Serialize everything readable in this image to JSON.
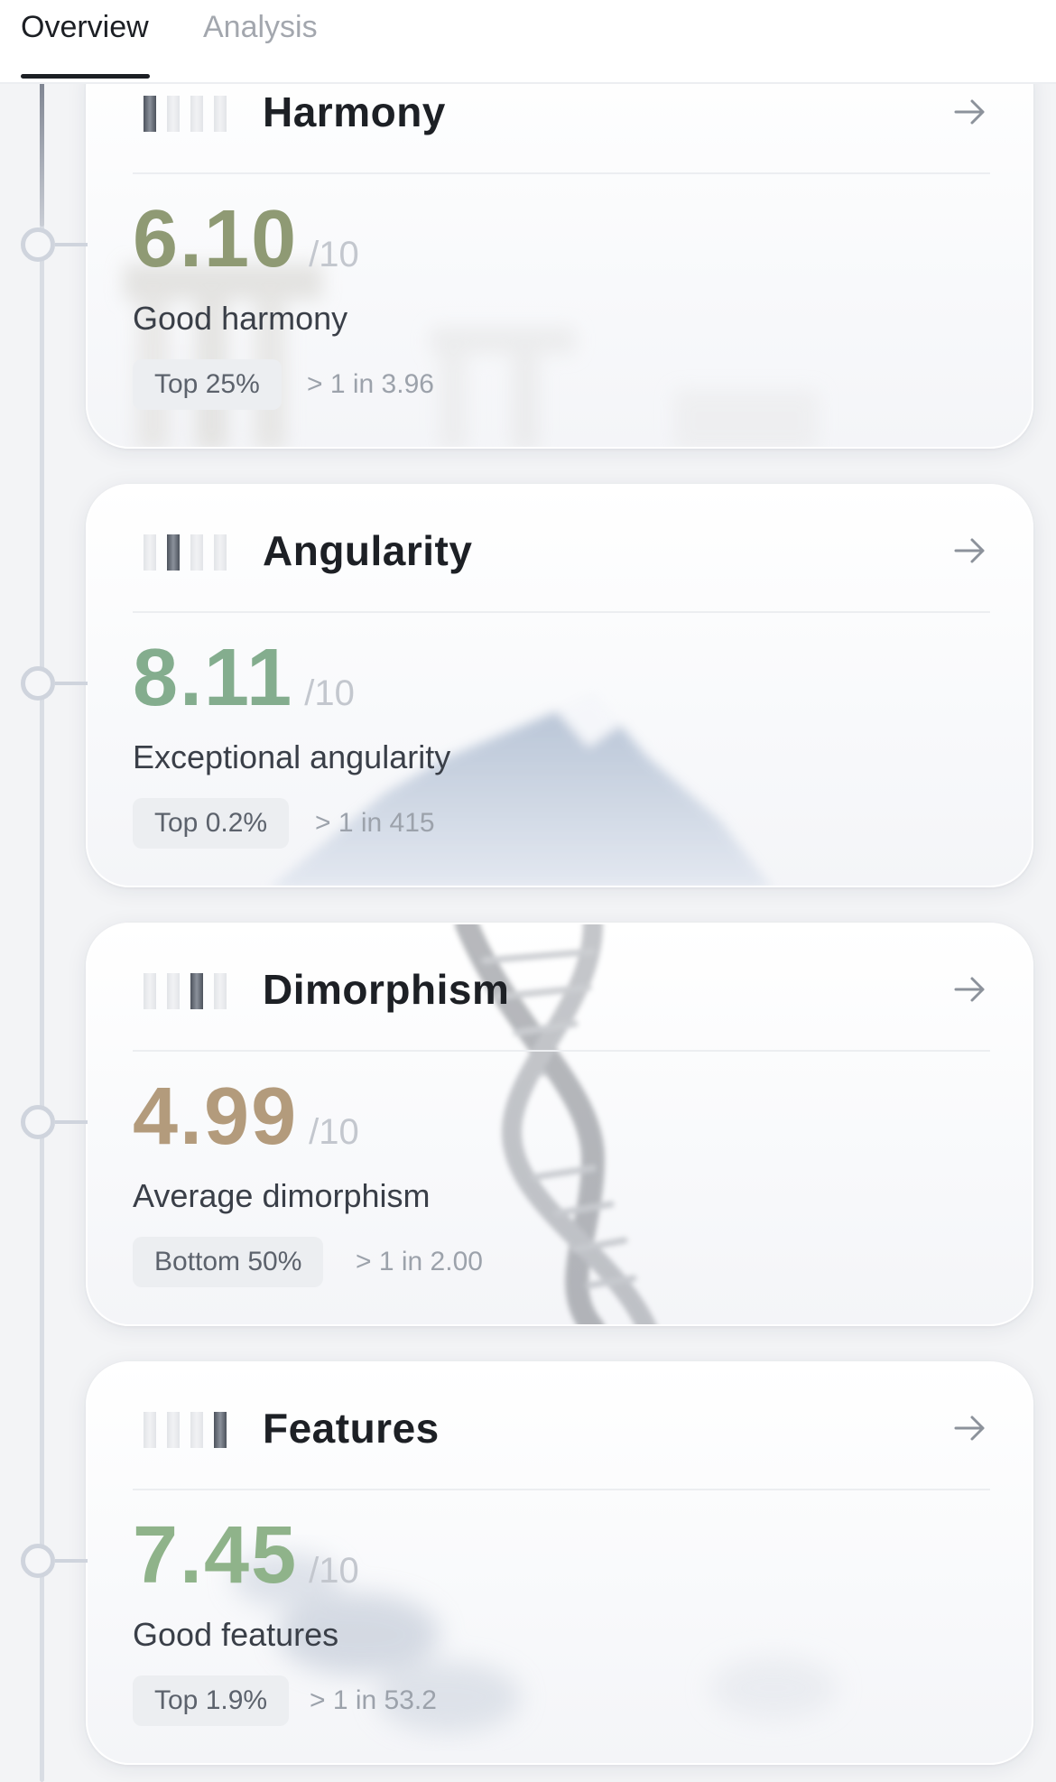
{
  "tabs": {
    "overview_label": "Overview",
    "analysis_label": "Analysis"
  },
  "colors": {
    "harmony_score": "#8f9a74",
    "angularity_score": "#84ad8e",
    "dimorphism_score": "#b39b7c",
    "features_score": "#8fb38a"
  },
  "cards": [
    {
      "title": "Harmony",
      "score": "6.10",
      "score_max": "/10",
      "description": "Good harmony",
      "badge": "Top 25%",
      "rarity": "> 1 in 3.96",
      "level": 1,
      "levels_total": 4,
      "icon": "right-arrow-icon"
    },
    {
      "title": "Angularity",
      "score": "8.11",
      "score_max": "/10",
      "description": "Exceptional angularity",
      "badge": "Top 0.2%",
      "rarity": "> 1 in 415",
      "level": 2,
      "levels_total": 4,
      "icon": "right-arrow-icon"
    },
    {
      "title": "Dimorphism",
      "score": "4.99",
      "score_max": "/10",
      "description": "Average dimorphism",
      "badge": "Bottom 50%",
      "rarity": "> 1 in 2.00",
      "level": 3,
      "levels_total": 4,
      "icon": "right-arrow-icon"
    },
    {
      "title": "Features",
      "score": "7.45",
      "score_max": "/10",
      "description": "Good features",
      "badge": "Top 1.9%",
      "rarity": "> 1 in 53.2",
      "level": 4,
      "levels_total": 4,
      "icon": "right-arrow-icon"
    }
  ]
}
